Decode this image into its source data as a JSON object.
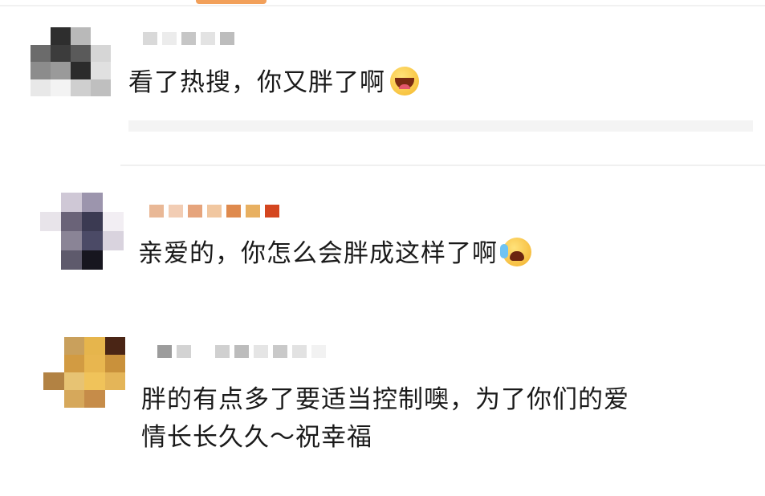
{
  "comments": [
    {
      "text": "看了热搜，你又胖了啊",
      "emoji": "grinning-face-emoji",
      "avatar_colors": [
        "#ffffff",
        "#2e2e2e",
        "#b9b9b9",
        "#ffffff",
        "#6b6b6b",
        "#3c3c3c",
        "#5a5a5a",
        "#d6d6d6",
        "#8c8c8c",
        "#9a9a9a",
        "#2b2b2b",
        "#e0e0e0",
        "#e8e8e8",
        "#f3f3f3",
        "#cfcfcf",
        "#bfbfbf"
      ],
      "name_colors": [
        "#d9d9d9",
        "#ececec",
        "#c6c6c6",
        "#e3e3e3",
        "#bdbdbd"
      ]
    },
    {
      "text": "亲爱的，你怎么会胖成这样了啊",
      "emoji": "crying-laughing-face-emoji",
      "avatar_colors": [
        "#ffffff",
        "#cfc8d6",
        "#9c95ad",
        "#ffffff",
        "#e8e4ea",
        "#6a6378",
        "#3b3a52",
        "#f2eef3",
        "#ffffff",
        "#8a8496",
        "#4b4a66",
        "#d9d3de",
        "#ffffff",
        "#5e5a6c",
        "#17161f",
        "#ffffff"
      ],
      "name_colors": [
        "#e9b896",
        "#f2cdb4",
        "#e6a47c",
        "#f1c7a0",
        "#df8a4d",
        "#e8b061",
        "#d4461f"
      ]
    },
    {
      "text_line1": "胖的有点多了要适当控制噢，为了你们的爱",
      "text_line2": "情长长久久～祝幸福",
      "avatar_colors": [
        "#ffffff",
        "#c9a05c",
        "#e6b54c",
        "#4a2515",
        "#ffffff",
        "#d29b42",
        "#e8b64f",
        "#c9913b",
        "#b28243",
        "#e7c373",
        "#f0c35a",
        "#e4b558",
        "#ffffff",
        "#d6a85b",
        "#c68c49",
        "#ffffff"
      ],
      "name_colors": [
        "#9c9c9c",
        "#d3d3d3",
        "#ffffff",
        "#d0d0d0",
        "#bcbcbc",
        "#e5e5e5",
        "#c9c9c9",
        "#e2e2e2",
        "#f2f2f2"
      ]
    }
  ]
}
